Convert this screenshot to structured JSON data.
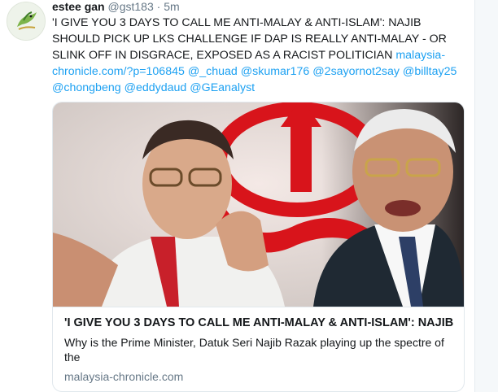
{
  "tweet": {
    "display_name": "estee gan",
    "handle": "@gst183",
    "separator": "·",
    "time": "5m",
    "text_main": "'I GIVE YOU 3 DAYS TO CALL ME ANTI-MALAY & ANTI-ISLAM': NAJIB SHOULD PICK UP LKS  CHALLENGE IF DAP IS REALLY ANTI-MALAY - OR SLINK OFF IN DISGRACE, EXPOSED AS A RACIST POLITICIAN",
    "url_text": "malaysia-chronicle.com/?p=106845",
    "mentions": [
      "@_chuad",
      "@skumar176",
      "@2sayornot2say",
      "@billtay25",
      "@chongbeng",
      "@eddydaud",
      "@GEanalyst"
    ]
  },
  "card": {
    "title": "'I GIVE YOU 3 DAYS TO CALL ME ANTI-MALAY & ANTI-ISLAM': NAJIB ...",
    "description": "Why is the Prime Minister, Datuk Seri Najib Razak playing up the spectre of the",
    "domain": "malaysia-chronicle.com"
  },
  "colors": {
    "link": "#1da1f2",
    "muted": "#657786",
    "text": "#14171a",
    "border": "#e1e8ed",
    "rocket_red": "#d8141b"
  },
  "icons": {
    "avatar": "bird-logo-icon",
    "caret": "chevron-down-icon"
  }
}
